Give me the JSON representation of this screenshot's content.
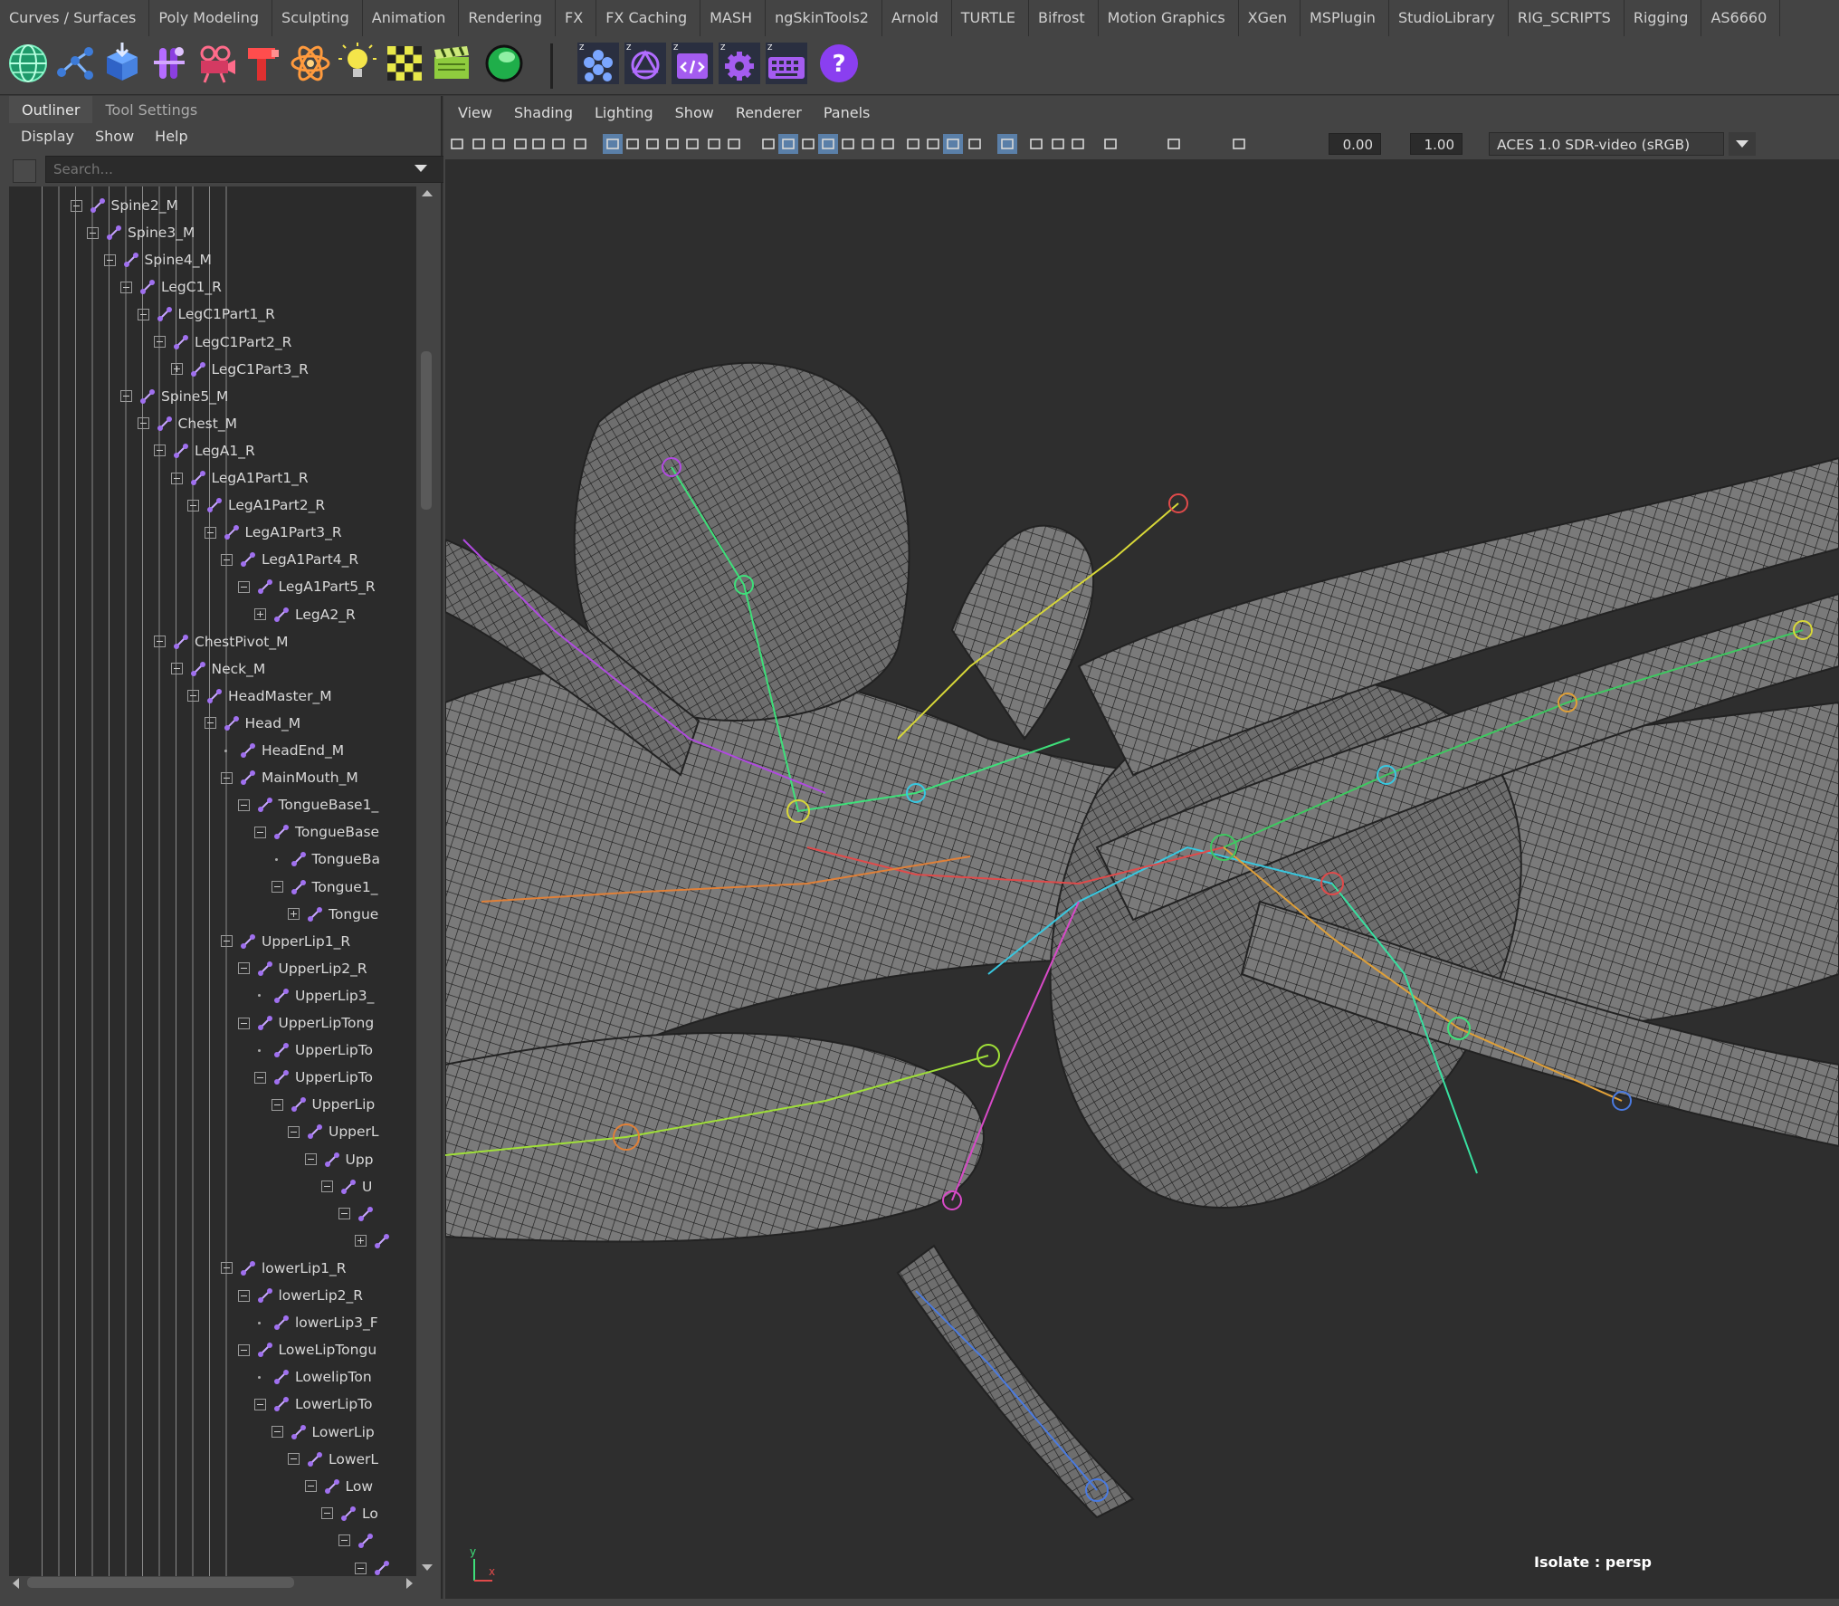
{
  "shelf": {
    "tabs": [
      "Curves / Surfaces",
      "Poly Modeling",
      "Sculpting",
      "Animation",
      "Rendering",
      "FX",
      "FX Caching",
      "MASH",
      "ngSkinTools2",
      "Arnold",
      "TURTLE",
      "Bifrost",
      "Motion Graphics",
      "XGen",
      "MSPlugin",
      "StudioLibrary",
      "RIG_SCRIPTS",
      "Rigging",
      "AS6660"
    ],
    "icons": [
      "globe-icon",
      "joint-chain-icon",
      "box-import-icon",
      "skeleton-icon",
      "camera-rig-icon",
      "hammer-icon",
      "atom-icon",
      "lightbulb-icon",
      "checker-icon",
      "clapper-icon",
      "sphere-icon",
      "z-honeycomb-icon",
      "z-openai-icon",
      "z-code-window-icon",
      "z-gear-icon",
      "z-keyboard-icon",
      "help-icon"
    ]
  },
  "outliner": {
    "tabs": [
      "Outliner",
      "Tool Settings"
    ],
    "menu": [
      "Display",
      "Show",
      "Help"
    ],
    "search_placeholder": "Search...",
    "nodes": [
      {
        "label": "Spine2_M",
        "depth": 5,
        "exp": "open"
      },
      {
        "label": "Spine3_M",
        "depth": 6,
        "exp": "open"
      },
      {
        "label": "Spine4_M",
        "depth": 7,
        "exp": "open"
      },
      {
        "label": "LegC1_R",
        "depth": 8,
        "exp": "open"
      },
      {
        "label": "LegC1Part1_R",
        "depth": 9,
        "exp": "open"
      },
      {
        "label": "LegC1Part2_R",
        "depth": 10,
        "exp": "open"
      },
      {
        "label": "LegC1Part3_R",
        "depth": 11,
        "exp": "closed"
      },
      {
        "label": "Spine5_M",
        "depth": 8,
        "exp": "open"
      },
      {
        "label": "Chest_M",
        "depth": 9,
        "exp": "open"
      },
      {
        "label": "LegA1_R",
        "depth": 10,
        "exp": "open"
      },
      {
        "label": "LegA1Part1_R",
        "depth": 11,
        "exp": "open"
      },
      {
        "label": "LegA1Part2_R",
        "depth": 12,
        "exp": "open"
      },
      {
        "label": "LegA1Part3_R",
        "depth": 13,
        "exp": "open"
      },
      {
        "label": "LegA1Part4_R",
        "depth": 14,
        "exp": "open"
      },
      {
        "label": "LegA1Part5_R",
        "depth": 15,
        "exp": "open"
      },
      {
        "label": "LegA2_R",
        "depth": 16,
        "exp": "closed"
      },
      {
        "label": "ChestPivot_M",
        "depth": 10,
        "exp": "open"
      },
      {
        "label": "Neck_M",
        "depth": 11,
        "exp": "open"
      },
      {
        "label": "HeadMaster_M",
        "depth": 12,
        "exp": "open"
      },
      {
        "label": "Head_M",
        "depth": 13,
        "exp": "open"
      },
      {
        "label": "HeadEnd_M",
        "depth": 14,
        "exp": "none"
      },
      {
        "label": "MainMouth_M",
        "depth": 14,
        "exp": "open"
      },
      {
        "label": "TongueBase1_",
        "depth": 15,
        "exp": "open"
      },
      {
        "label": "TongueBase",
        "depth": 16,
        "exp": "open"
      },
      {
        "label": "TongueBa",
        "depth": 17,
        "exp": "none"
      },
      {
        "label": "Tongue1_",
        "depth": 17,
        "exp": "open"
      },
      {
        "label": "Tongue",
        "depth": 18,
        "exp": "closed"
      },
      {
        "label": "UpperLip1_R",
        "depth": 14,
        "exp": "open"
      },
      {
        "label": "UpperLip2_R",
        "depth": 15,
        "exp": "open"
      },
      {
        "label": "UpperLip3_",
        "depth": 16,
        "exp": "none"
      },
      {
        "label": "UpperLipTong",
        "depth": 15,
        "exp": "open"
      },
      {
        "label": "UpperLipTo",
        "depth": 16,
        "exp": "none"
      },
      {
        "label": "UpperLipTo",
        "depth": 16,
        "exp": "open"
      },
      {
        "label": "UpperLip",
        "depth": 17,
        "exp": "open"
      },
      {
        "label": "UpperL",
        "depth": 18,
        "exp": "open"
      },
      {
        "label": "Upp",
        "depth": 19,
        "exp": "open"
      },
      {
        "label": "U",
        "depth": 20,
        "exp": "open"
      },
      {
        "label": "",
        "depth": 21,
        "exp": "open"
      },
      {
        "label": "",
        "depth": 22,
        "exp": "closed"
      },
      {
        "label": "lowerLip1_R",
        "depth": 14,
        "exp": "open"
      },
      {
        "label": "lowerLip2_R",
        "depth": 15,
        "exp": "open"
      },
      {
        "label": "lowerLip3_F",
        "depth": 16,
        "exp": "none"
      },
      {
        "label": "LoweLipTongu",
        "depth": 15,
        "exp": "open"
      },
      {
        "label": "LowelipTon",
        "depth": 16,
        "exp": "none"
      },
      {
        "label": "LowerLipTo",
        "depth": 16,
        "exp": "open"
      },
      {
        "label": "LowerLip",
        "depth": 17,
        "exp": "open"
      },
      {
        "label": "LowerL",
        "depth": 18,
        "exp": "open"
      },
      {
        "label": "Low",
        "depth": 19,
        "exp": "open"
      },
      {
        "label": "Lo",
        "depth": 20,
        "exp": "open"
      },
      {
        "label": "",
        "depth": 21,
        "exp": "open"
      },
      {
        "label": "",
        "depth": 22,
        "exp": "open"
      }
    ]
  },
  "viewport": {
    "menu": [
      "View",
      "Shading",
      "Lighting",
      "Show",
      "Renderer",
      "Panels"
    ],
    "exposure": "0.00",
    "gamma": "1.00",
    "color_space": "ACES 1.0 SDR-video (sRGB)",
    "camera_label": "Isolate : persp",
    "axis": {
      "x": "x",
      "y": "y"
    }
  }
}
